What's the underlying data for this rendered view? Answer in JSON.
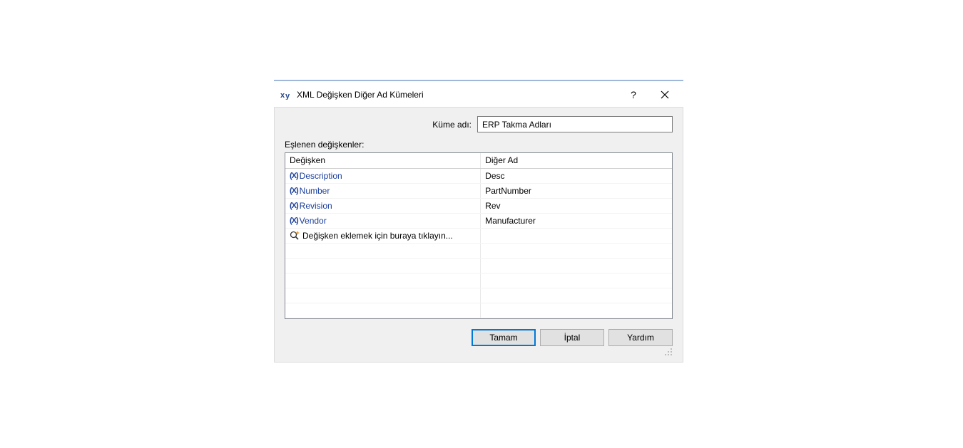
{
  "titlebar": {
    "icon_label": "xy-icon",
    "title": "XML Değişken Diğer Ad Kümeleri",
    "help_label": "?",
    "close_label": "Close"
  },
  "form": {
    "set_name_label": "Küme adı:",
    "set_name_value": "ERP Takma Adları",
    "mapped_label": "Eşlenen değişkenler:"
  },
  "grid": {
    "headers": {
      "variable": "Değişken",
      "alias": "Diğer Ad"
    },
    "rows": [
      {
        "variable": "Description",
        "alias": "Desc"
      },
      {
        "variable": "Number",
        "alias": "PartNumber"
      },
      {
        "variable": "Revision",
        "alias": "Rev"
      },
      {
        "variable": "Vendor",
        "alias": "Manufacturer"
      }
    ],
    "add_hint": "Değişken eklemek için buraya tıklayın..."
  },
  "buttons": {
    "ok": "Tamam",
    "cancel": "İptal",
    "help": "Yardım"
  }
}
